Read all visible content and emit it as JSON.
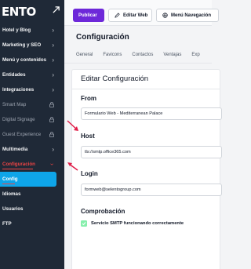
{
  "sidebar": {
    "logo": "ENTO",
    "items": [
      {
        "label": "Hotel y Blog",
        "indicator": "chevron"
      },
      {
        "label": "Marketing y SEO",
        "indicator": "chevron"
      },
      {
        "label": "Menú y contenidos",
        "indicator": "chevron"
      },
      {
        "label": "Entidades",
        "indicator": "chevron"
      },
      {
        "label": "Integraciones",
        "indicator": "chevron"
      },
      {
        "label": "Smart Map",
        "indicator": "lock"
      },
      {
        "label": "Digital Signage",
        "indicator": "lock"
      },
      {
        "label": "Guest Experience",
        "indicator": "lock"
      },
      {
        "label": "Multimedia",
        "indicator": "chevron"
      },
      {
        "label": "Configuración",
        "indicator": "chevron-down",
        "state": "active"
      },
      {
        "label": "Config",
        "state": "selected"
      },
      {
        "label": "Idiomas"
      },
      {
        "label": "Usuarios"
      },
      {
        "label": "FTP"
      }
    ]
  },
  "toolbar": {
    "publish_label": "Publicar",
    "edit_web_label": "Editar Web",
    "menu_nav_label": "Menú Navegación"
  },
  "page": {
    "title": "Configuración",
    "tabs": [
      "General",
      "Favicons",
      "Contactos",
      "Ventajas",
      "Exp"
    ]
  },
  "form": {
    "title": "Editar Configuración",
    "from_label": "From",
    "from_value": "Formulario Web - Mediterranean Palace",
    "host_label": "Host",
    "host_value": "tls://smtp.office365.com",
    "login_label": "Login",
    "login_value": "formweb@selentogroup.com",
    "check_label": "Comprobación",
    "status_text": "Servicio SMTP funcionando correctamente"
  },
  "colors": {
    "sidebar_bg": "#1f2937",
    "publish_bg": "#6d28d9",
    "selected_bg": "#0ea5e9",
    "active_text": "#ef4444",
    "success": "#86efac",
    "annotation_arrow": "#e11d48"
  }
}
